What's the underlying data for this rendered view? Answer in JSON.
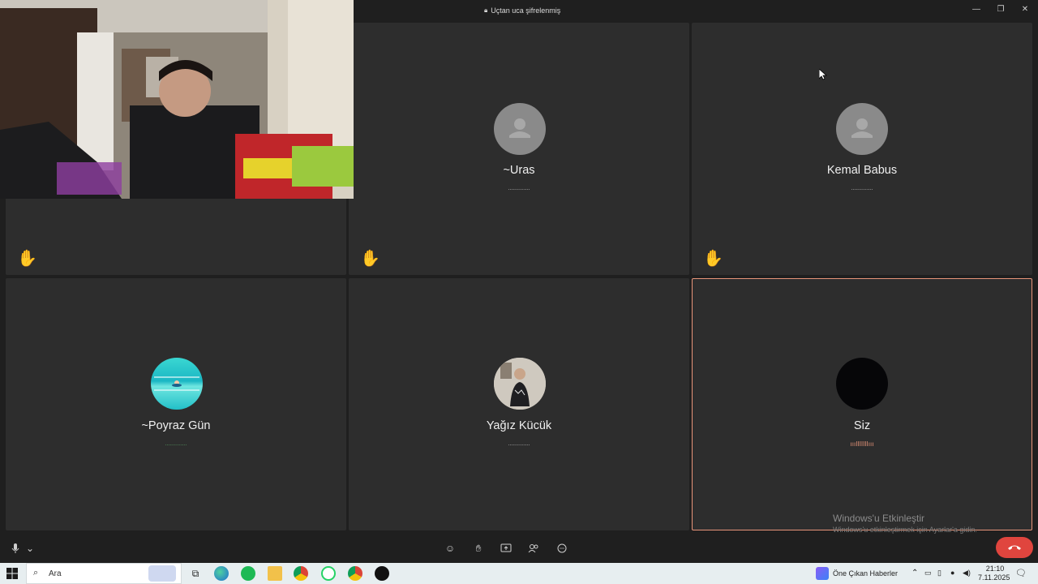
{
  "window": {
    "encryption_label": "Uçtan uca şifrelenmiş"
  },
  "participants": [
    {
      "name": "~Uras",
      "hand_raised": true,
      "avatar": "placeholder",
      "wave_color": "#c8c8c8"
    },
    {
      "name": "Kemal Babus",
      "hand_raised": true,
      "avatar": "placeholder",
      "wave_color": "#c8c8c8"
    },
    {
      "name": "~Poyraz Gün",
      "hand_raised": false,
      "avatar": "photo-pool",
      "wave_color": "#5fb36b"
    },
    {
      "name": "Yağız Kücük",
      "hand_raised": false,
      "avatar": "photo-person",
      "wave_color": "#c8c8c8"
    },
    {
      "name": "Siz",
      "hand_raised": false,
      "avatar": "dark",
      "wave_color": "#e8957a"
    }
  ],
  "self_video_tile_hand": true,
  "hand_icon": "✋",
  "wave_dots": "..............",
  "active_wave": "ıııIIIIIIIııı",
  "controls": {
    "mic_icon": "microphone-icon",
    "end_call_icon": "phone-hangup-icon"
  },
  "watermark": {
    "title": "Windows'u Etkinleştir",
    "subtitle": "Windows'u etkinleştirmek için Ayarlar'a gidin."
  },
  "taskbar": {
    "search_placeholder": "Ara",
    "news_label": "Öne Çıkan Haberler",
    "time": "21:10",
    "date": "7.11.2025"
  },
  "colors": {
    "tile_bg": "#2d2d2d",
    "app_bg": "#1f1f1f",
    "active_border": "#e8957a",
    "end_call": "#e0453e"
  }
}
